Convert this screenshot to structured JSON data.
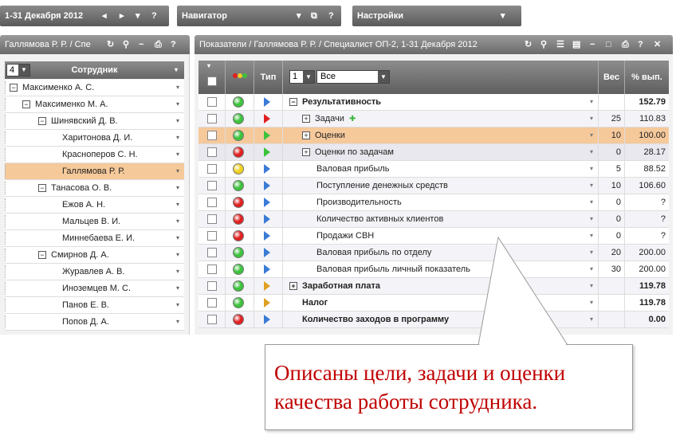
{
  "toolbar": {
    "period": "1-31 Декабря 2012",
    "navigator": "Навигатор",
    "settings": "Настройки"
  },
  "left_panel": {
    "title": "Галлямова Р. Р. / Спе",
    "page_select": "4",
    "column_header": "Сотрудник",
    "employees": [
      {
        "name": "Максименко А. С.",
        "level": 0,
        "expandable": true
      },
      {
        "name": "Максименко М. А.",
        "level": 1,
        "expandable": true
      },
      {
        "name": "Шинявский Д. В.",
        "level": 2,
        "expandable": true
      },
      {
        "name": "Харитонова Д. И.",
        "level": 3,
        "expandable": false
      },
      {
        "name": "Красноперов С. Н.",
        "level": 3,
        "expandable": false
      },
      {
        "name": "Галлямова Р. Р.",
        "level": 3,
        "expandable": false,
        "selected": true
      },
      {
        "name": "Танасова О. В.",
        "level": 2,
        "expandable": true
      },
      {
        "name": "Ежов А. Н.",
        "level": 3,
        "expandable": false
      },
      {
        "name": "Мальцев В. И.",
        "level": 3,
        "expandable": false
      },
      {
        "name": "Миннебаева Е. И.",
        "level": 3,
        "expandable": false
      },
      {
        "name": "Смирнов Д. А.",
        "level": 2,
        "expandable": true
      },
      {
        "name": "Журавлев А. В.",
        "level": 3,
        "expandable": false
      },
      {
        "name": "Иноземцев М. С.",
        "level": 3,
        "expandable": false
      },
      {
        "name": "Панов Е. В.",
        "level": 3,
        "expandable": false
      },
      {
        "name": "Попов Д. А.",
        "level": 3,
        "expandable": false
      }
    ]
  },
  "right_panel": {
    "title": "Показатели / Галлямова Р. Р. / Специалист ОП-2, 1-31 Декабря 2012",
    "headers": {
      "type": "Тип",
      "level_select": "1",
      "filter_select": "Все",
      "weight": "Вес",
      "percent": "% вып."
    },
    "rows": [
      {
        "name": "Результативность",
        "status": "#3cc23c",
        "arrow": "#3a7bd5",
        "bold": true,
        "expand": "−",
        "indent": 0,
        "weight": "",
        "percent": "152.79"
      },
      {
        "name": "Задачи",
        "status": "#3cc23c",
        "arrow": "#e02020",
        "bold": false,
        "expand": "+",
        "indent": 1,
        "weight": "25",
        "percent": "110.83",
        "plus": "✚"
      },
      {
        "name": "Оценки",
        "status": "#3cc23c",
        "arrow": "#3cc23c",
        "bold": false,
        "expand": "+",
        "indent": 1,
        "weight": "10",
        "percent": "100.00",
        "selected": true
      },
      {
        "name": "Оценки по задачам",
        "status": "#e02020",
        "arrow": "#3cc23c",
        "bold": false,
        "expand": "+",
        "indent": 1,
        "weight": "0",
        "percent": "28.17",
        "highlight": true
      },
      {
        "name": "Валовая прибыль",
        "status": "#f0d020",
        "arrow": "#3a7bd5",
        "bold": false,
        "expand": "",
        "indent": 2,
        "weight": "5",
        "percent": "88.52"
      },
      {
        "name": "Поступление денежных средств",
        "status": "#3cc23c",
        "arrow": "#3a7bd5",
        "bold": false,
        "expand": "",
        "indent": 2,
        "weight": "10",
        "percent": "106.60"
      },
      {
        "name": "Производительность",
        "status": "#e02020",
        "arrow": "#3a7bd5",
        "bold": false,
        "expand": "",
        "indent": 2,
        "weight": "0",
        "percent": "?"
      },
      {
        "name": "Количество активных клиентов",
        "status": "#e02020",
        "arrow": "#3a7bd5",
        "bold": false,
        "expand": "",
        "indent": 2,
        "weight": "0",
        "percent": "?"
      },
      {
        "name": "Продажи СВН",
        "status": "#e02020",
        "arrow": "#3a7bd5",
        "bold": false,
        "expand": "",
        "indent": 2,
        "weight": "0",
        "percent": "?"
      },
      {
        "name": "Валовая прибыль по отделу",
        "status": "#3cc23c",
        "arrow": "#3a7bd5",
        "bold": false,
        "expand": "",
        "indent": 2,
        "weight": "20",
        "percent": "200.00"
      },
      {
        "name": "Валовая прибыль личный показатель",
        "status": "#3cc23c",
        "arrow": "#3a7bd5",
        "bold": false,
        "expand": "",
        "indent": 2,
        "weight": "30",
        "percent": "200.00"
      },
      {
        "name": "Заработная плата",
        "status": "#3cc23c",
        "arrow": "#e0a020",
        "bold": true,
        "expand": "+",
        "indent": 0,
        "weight": "",
        "percent": "119.78"
      },
      {
        "name": "Налог",
        "status": "#3cc23c",
        "arrow": "#e0a020",
        "bold": true,
        "expand": "",
        "indent": 1,
        "weight": "",
        "percent": "119.78"
      },
      {
        "name": "Количество заходов в программу",
        "status": "#e02020",
        "arrow": "#3a7bd5",
        "bold": true,
        "expand": "",
        "indent": 1,
        "weight": "",
        "percent": "0.00"
      }
    ]
  },
  "callout": {
    "text": "Описаны цели, задачи и оценки качества работы сотрудника."
  }
}
